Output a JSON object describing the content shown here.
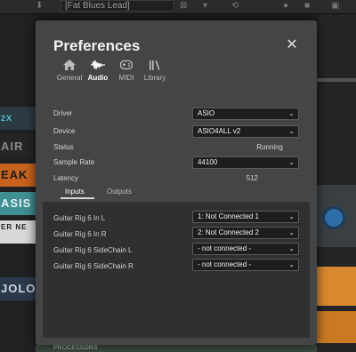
{
  "host": {
    "preset_name": "[Fat Blues Lead]",
    "sidebar_tiles": [
      "2X",
      "AIR",
      "EAK",
      "ASIS",
      "ER NE",
      "JOLO"
    ],
    "bottom_text": "PROCESSORS"
  },
  "dialog": {
    "title": "Preferences",
    "close_glyph": "✕",
    "tabs": [
      {
        "label": "General",
        "icon": "home-icon"
      },
      {
        "label": "Audio",
        "icon": "waveform-icon",
        "active": true
      },
      {
        "label": "MIDI",
        "icon": "midi-controller-icon"
      },
      {
        "label": "Library",
        "icon": "library-icon"
      }
    ],
    "settings": {
      "driver": {
        "label": "Driver",
        "value": "ASIO"
      },
      "device": {
        "label": "Device",
        "value": "ASIO4ALL v2"
      },
      "status": {
        "label": "Status",
        "value": "Running"
      },
      "sample_rate": {
        "label": "Sample Rate",
        "value": "44100"
      },
      "latency": {
        "label": "Latency",
        "value": "512"
      }
    },
    "io_tabs": [
      {
        "label": "Inputs",
        "active": true
      },
      {
        "label": "Outputs"
      }
    ],
    "inputs": [
      {
        "label": "Guitar Rig 6 In L",
        "value": "1: Not Connected 1"
      },
      {
        "label": "Guitar Rig 6 In R",
        "value": "2: Not Connected 2"
      },
      {
        "label": "Guitar Rig 6 SideChain L",
        "value": "- not connected -"
      },
      {
        "label": "Guitar Rig 6 SideChain R",
        "value": "- not connected -"
      }
    ],
    "chevron": "⌄"
  },
  "colors": {
    "dialog_bg": "#444546",
    "panel_bg": "#2f3031",
    "accent_orange": "#d9892e",
    "accent_blue": "#2e6da8"
  }
}
